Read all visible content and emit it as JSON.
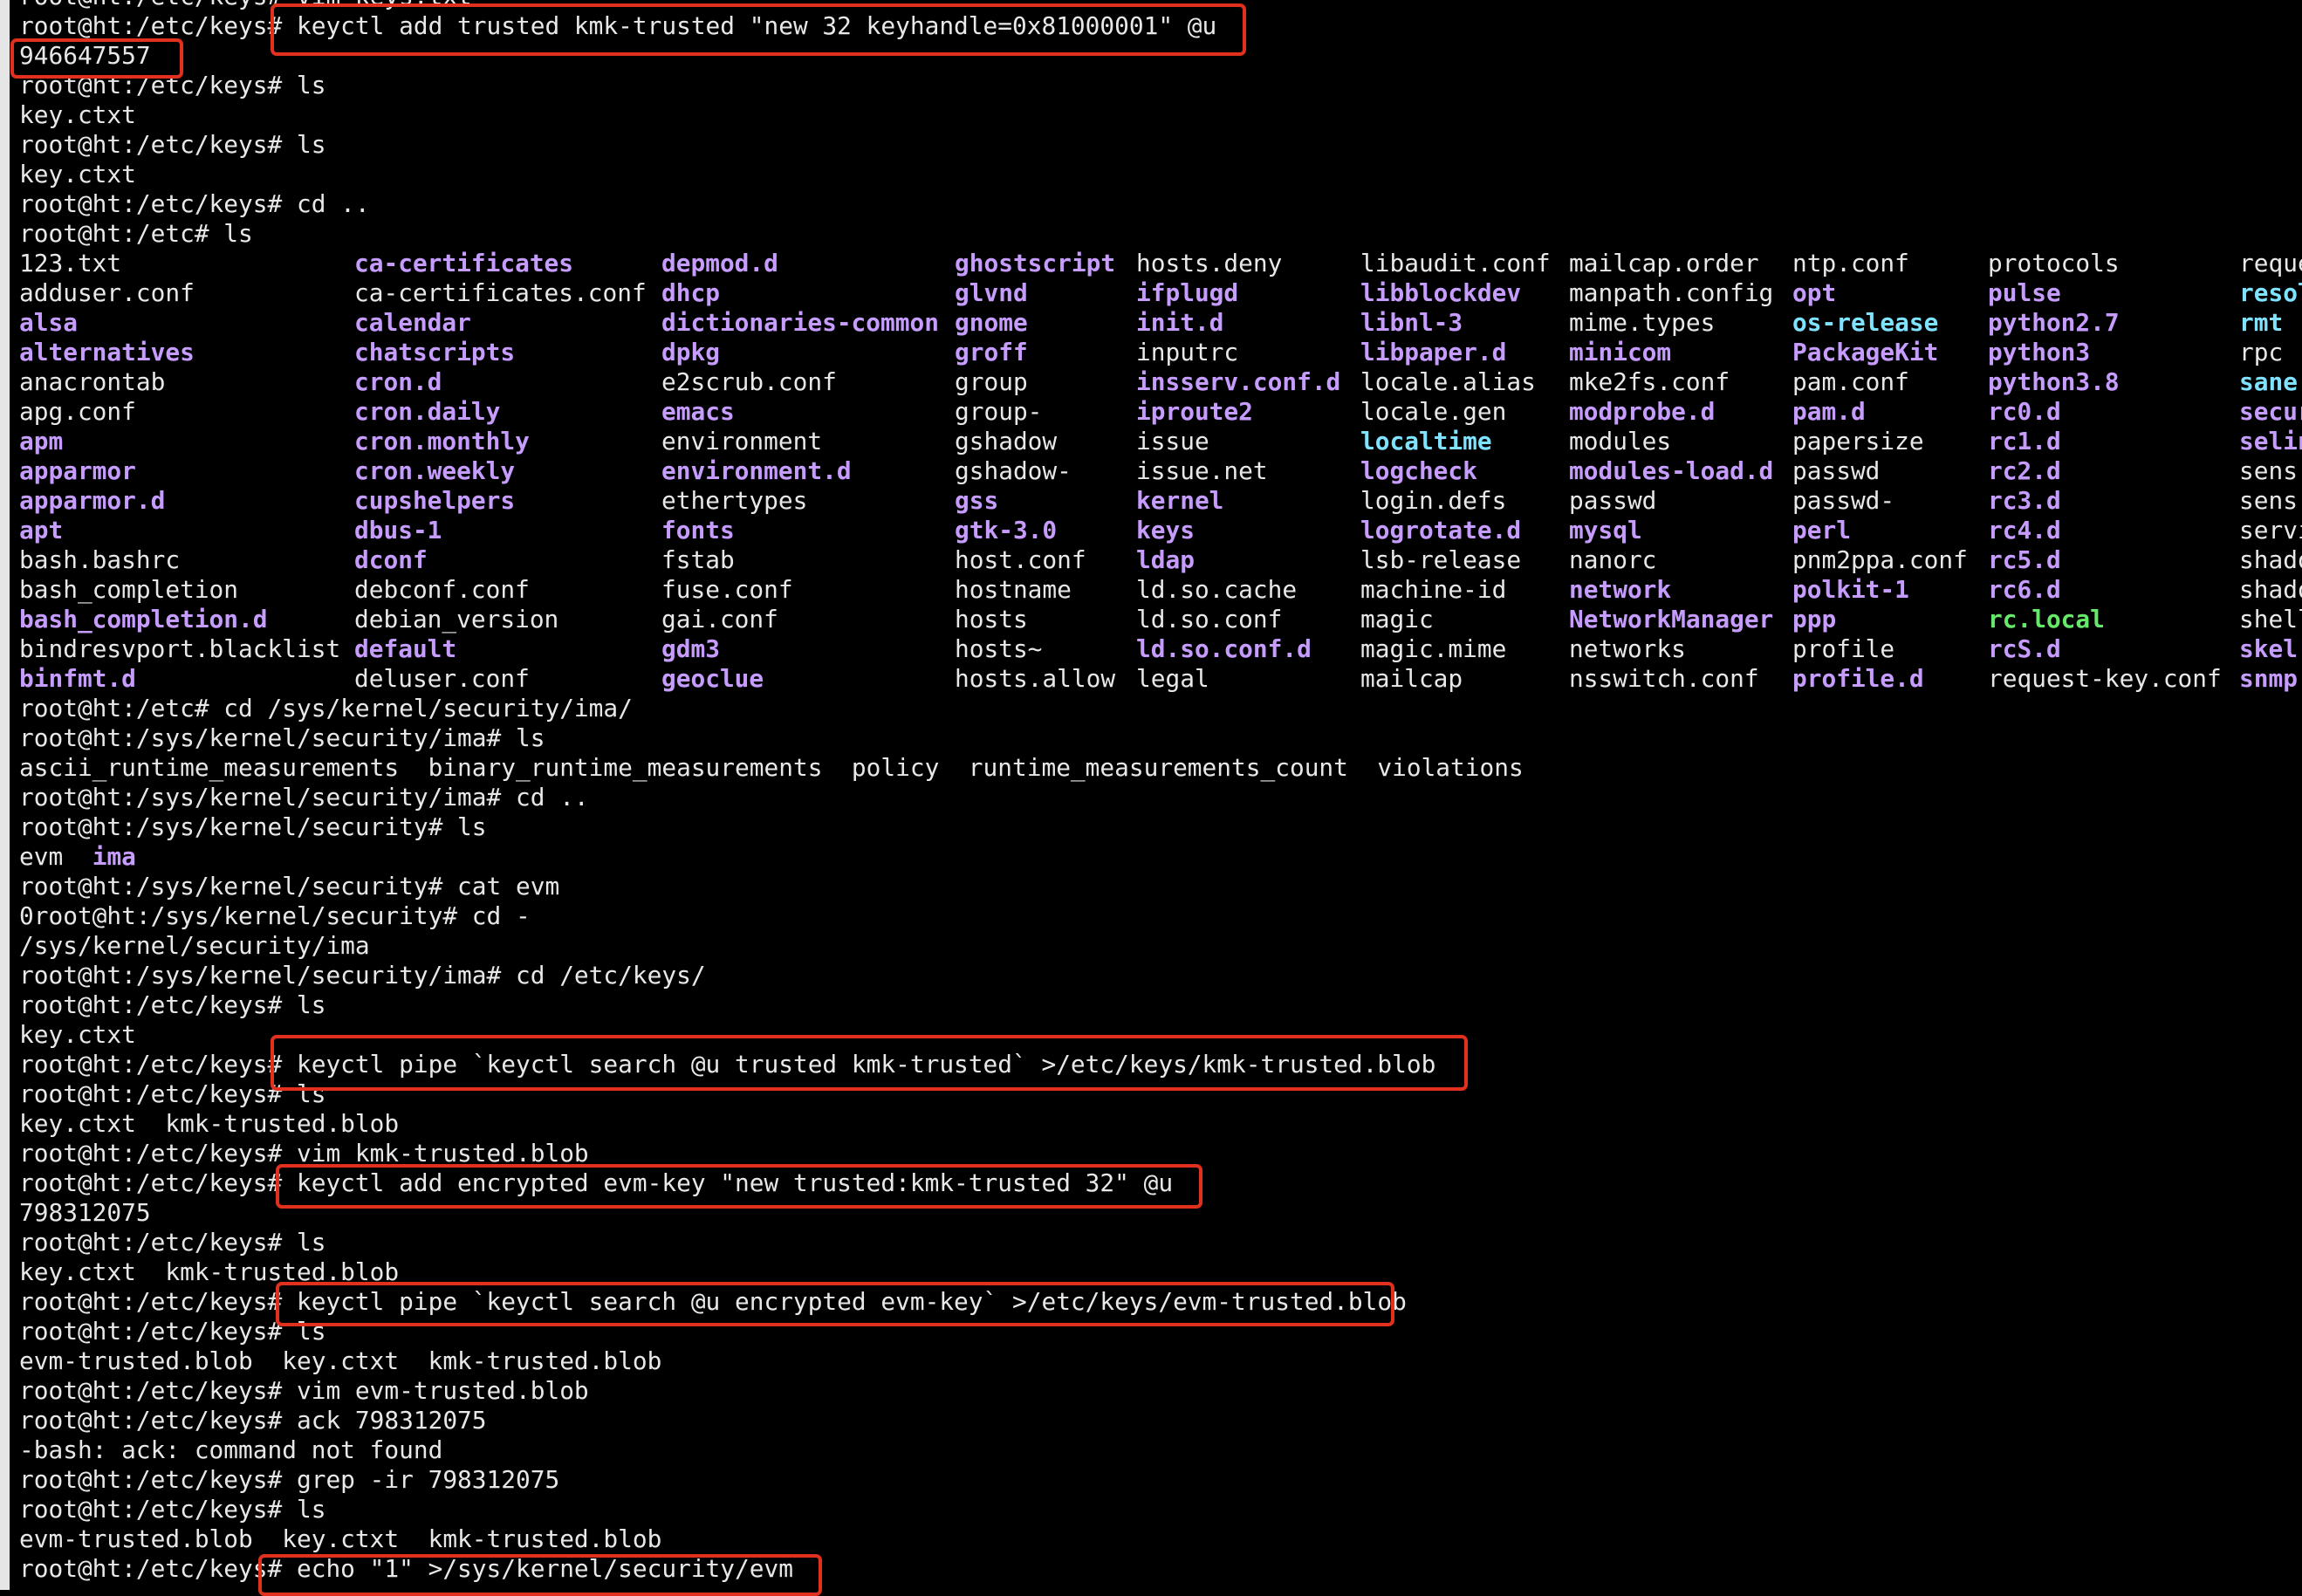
{
  "terminal": {
    "top_partial": "root@ht:/etc/keys# vim keys.txt",
    "lines": [
      "root@ht:/etc/keys# keyctl add trusted kmk-trusted \"new 32 keyhandle=0x81000001\" @u",
      "946647557",
      "root@ht:/etc/keys# ls",
      "key.ctxt",
      "root@ht:/etc/keys# ls",
      "key.ctxt",
      "root@ht:/etc/keys# cd ..",
      "root@ht:/etc# ls"
    ],
    "lines_after_ls": [
      "root@ht:/etc# cd /sys/kernel/security/ima/",
      "root@ht:/sys/kernel/security/ima# ls",
      "ascii_runtime_measurements  binary_runtime_measurements  policy  runtime_measurements_count  violations",
      "root@ht:/sys/kernel/security/ima# cd ..",
      "root@ht:/sys/kernel/security# ls"
    ],
    "evm_ls": {
      "file": "evm",
      "dir": "ima"
    },
    "lines_tail": [
      "root@ht:/sys/kernel/security# cat evm",
      "0root@ht:/sys/kernel/security# cd -",
      "/sys/kernel/security/ima",
      "root@ht:/sys/kernel/security/ima# cd /etc/keys/",
      "root@ht:/etc/keys# ls",
      "key.ctxt",
      "root@ht:/etc/keys# keyctl pipe `keyctl search @u trusted kmk-trusted` >/etc/keys/kmk-trusted.blob",
      "root@ht:/etc/keys# ls",
      "key.ctxt  kmk-trusted.blob",
      "root@ht:/etc/keys# vim kmk-trusted.blob",
      "root@ht:/etc/keys# keyctl add encrypted evm-key \"new trusted:kmk-trusted 32\" @u",
      "798312075",
      "root@ht:/etc/keys# ls",
      "key.ctxt  kmk-trusted.blob",
      "root@ht:/etc/keys# keyctl pipe `keyctl search @u encrypted evm-key` >/etc/keys/evm-trusted.blob",
      "root@ht:/etc/keys# ls",
      "evm-trusted.blob  key.ctxt  kmk-trusted.blob",
      "root@ht:/etc/keys# vim evm-trusted.blob",
      "root@ht:/etc/keys# ack 798312075",
      "-bash: ack: command not found",
      "root@ht:/etc/keys# grep -ir 798312075",
      "root@ht:/etc/keys# ls",
      "evm-trusted.blob  key.ctxt  kmk-trusted.blob",
      "root@ht:/etc/keys# echo \"1\" >/sys/kernel/security/evm"
    ],
    "ls_columns": [
      [
        "123.txt",
        "adduser.conf",
        "alsa",
        "alternatives",
        "anacrontab",
        "apg.conf",
        "apm",
        "apparmor",
        "apparmor.d",
        "apt",
        "bash.bashrc",
        "bash_completion",
        "bash_completion.d",
        "bindresvport.blacklist",
        "binfmt.d"
      ],
      [
        "ca-certificates",
        "ca-certificates.conf",
        "calendar",
        "chatscripts",
        "cron.d",
        "cron.daily",
        "cron.monthly",
        "cron.weekly",
        "cupshelpers",
        "dbus-1",
        "dconf",
        "debconf.conf",
        "debian_version",
        "default",
        "deluser.conf"
      ],
      [
        "depmod.d",
        "dhcp",
        "dictionaries-common",
        "dpkg",
        "e2scrub.conf",
        "emacs",
        "environment",
        "environment.d",
        "ethertypes",
        "fonts",
        "fstab",
        "fuse.conf",
        "gai.conf",
        "gdm3",
        "geoclue"
      ],
      [
        "ghostscript",
        "glvnd",
        "gnome",
        "groff",
        "group",
        "group-",
        "gshadow",
        "gshadow-",
        "gss",
        "gtk-3.0",
        "host.conf",
        "hostname",
        "hosts",
        "hosts~",
        "hosts.allow"
      ],
      [
        "hosts.deny",
        "ifplugd",
        "init.d",
        "inputrc",
        "insserv.conf.d",
        "iproute2",
        "issue",
        "issue.net",
        "kernel",
        "keys",
        "ldap",
        "ld.so.cache",
        "ld.so.conf",
        "ld.so.conf.d",
        "legal"
      ],
      [
        "libaudit.conf",
        "libblockdev",
        "libnl-3",
        "libpaper.d",
        "locale.alias",
        "locale.gen",
        "localtime",
        "logcheck",
        "login.defs",
        "logrotate.d",
        "lsb-release",
        "machine-id",
        "magic",
        "magic.mime",
        "mailcap"
      ],
      [
        "mailcap.order",
        "manpath.config",
        "mime.types",
        "minicom",
        "mke2fs.conf",
        "modprobe.d",
        "modules",
        "modules-load.d",
        "passwd",
        "mysql",
        "nanorc",
        "network",
        "NetworkManager",
        "networks",
        "nsswitch.conf"
      ],
      [
        "ntp.conf",
        "opt",
        "os-release",
        "PackageKit",
        "pam.conf",
        "pam.d",
        "papersize",
        "passwd",
        "passwd-",
        "perl",
        "pnm2ppa.conf",
        "polkit-1",
        "ppp",
        "profile",
        "profile.d"
      ],
      [
        "protocols",
        "pulse",
        "python2.7",
        "python3",
        "python3.8",
        "rc0.d",
        "rc1.d",
        "rc2.d",
        "rc3.d",
        "rc4.d",
        "rc5.d",
        "rc6.d",
        "rc.local",
        "rcS.d",
        "request-key.conf"
      ],
      [
        "reque",
        "resol",
        "rmt",
        "rpc",
        "sane.",
        "secur",
        "selin",
        "sens",
        "sens",
        "servi",
        "shado",
        "shado",
        "shell",
        "skel",
        "snmp"
      ]
    ],
    "ls_types": [
      [
        "plain",
        "plain",
        "dir",
        "dir",
        "plain",
        "plain",
        "dir",
        "dir",
        "dir",
        "dir",
        "plain",
        "plain",
        "dir",
        "plain",
        "dir"
      ],
      [
        "dir",
        "plain",
        "dir",
        "dir",
        "dir",
        "dir",
        "dir",
        "dir",
        "dir",
        "dir",
        "dir",
        "plain",
        "plain",
        "dir",
        "plain"
      ],
      [
        "dir",
        "dir",
        "dir",
        "dir",
        "plain",
        "dir",
        "plain",
        "dir",
        "plain",
        "dir",
        "plain",
        "plain",
        "plain",
        "dir",
        "dir"
      ],
      [
        "dir",
        "dir",
        "dir",
        "dir",
        "plain",
        "plain",
        "plain",
        "plain",
        "dir",
        "dir",
        "plain",
        "plain",
        "plain",
        "plain",
        "plain"
      ],
      [
        "plain",
        "dir",
        "dir",
        "plain",
        "dir",
        "dir",
        "plain",
        "plain",
        "dir",
        "dir",
        "dir",
        "plain",
        "plain",
        "dir",
        "plain"
      ],
      [
        "plain",
        "dir",
        "dir",
        "dir",
        "plain",
        "plain",
        "link",
        "dir",
        "plain",
        "dir",
        "plain",
        "plain",
        "plain",
        "plain",
        "plain"
      ],
      [
        "plain",
        "plain",
        "plain",
        "dir",
        "plain",
        "dir",
        "plain",
        "dir",
        "plain",
        "dir",
        "plain",
        "dir",
        "dir",
        "plain",
        "plain"
      ],
      [
        "plain",
        "dir",
        "link",
        "dir",
        "plain",
        "dir",
        "plain",
        "plain",
        "plain",
        "dir",
        "plain",
        "dir",
        "dir",
        "plain",
        "dir"
      ],
      [
        "plain",
        "dir",
        "dir",
        "dir",
        "dir",
        "dir",
        "dir",
        "dir",
        "dir",
        "dir",
        "dir",
        "dir",
        "exec",
        "dir",
        "plain"
      ],
      [
        "plain",
        "link",
        "link",
        "plain",
        "link",
        "dir",
        "dir",
        "plain",
        "plain",
        "plain",
        "plain",
        "plain",
        "plain",
        "dir",
        "dir"
      ]
    ]
  },
  "colors": {
    "background": "#000000",
    "text": "#e8e8e8",
    "directory": "#c79cff",
    "symlink": "#7fe3ff",
    "executable": "#66e86a",
    "highlight_box": "#e2301f"
  }
}
